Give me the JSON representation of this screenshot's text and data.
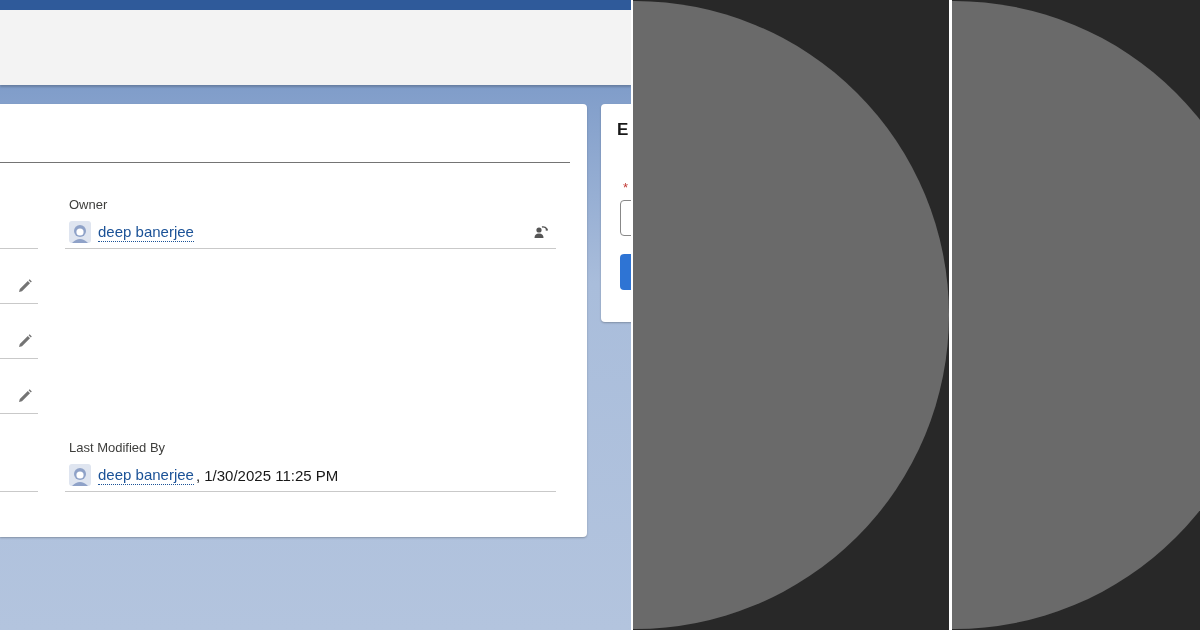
{
  "record_card": {
    "left_rows": [
      {
        "editable": false
      },
      {
        "editable": true
      },
      {
        "editable": true
      },
      {
        "editable": true
      },
      {
        "editable": false
      }
    ],
    "owner": {
      "label": "Owner",
      "user": "deep banerjee"
    },
    "last_modified": {
      "label": "Last Modified By",
      "user": "deep banerjee",
      "date": ", 1/30/2025 11:25 PM"
    }
  },
  "side_panel": {
    "title": "E",
    "required_mark": "*"
  }
}
